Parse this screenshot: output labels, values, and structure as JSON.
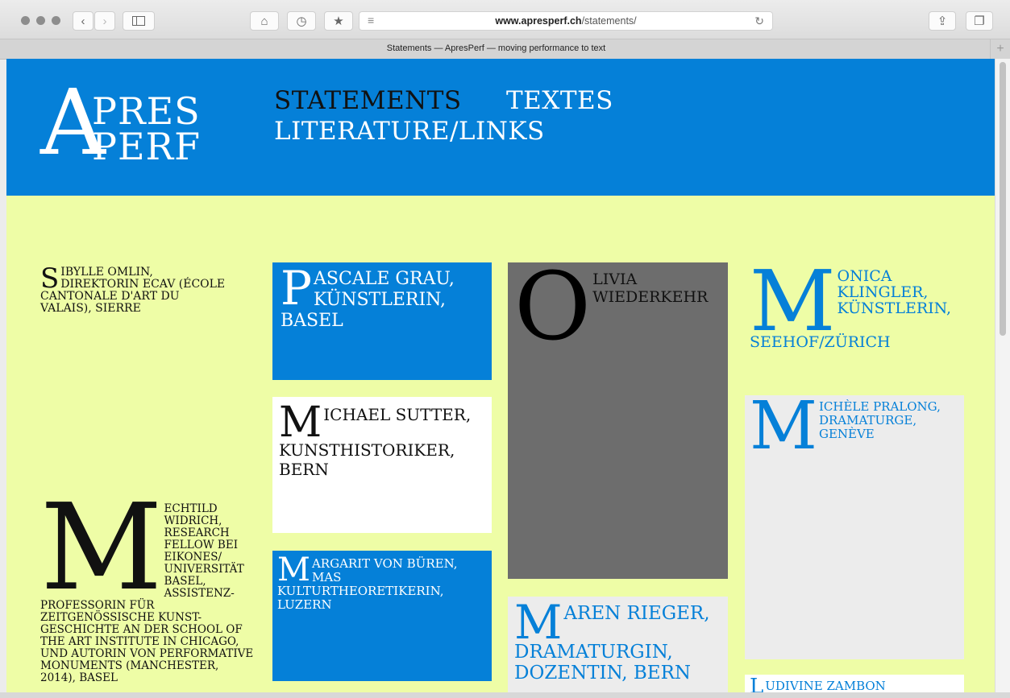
{
  "browser": {
    "url_host": "www.apresperf.ch",
    "url_path": "/statements/",
    "tab_title": "Statements — ApresPerf — moving performance to text"
  },
  "site": {
    "logo": {
      "big_letter": "A",
      "line1": "PRES",
      "line2": "PERF"
    },
    "nav": [
      {
        "label": "STATEMENTS",
        "active": true
      },
      {
        "label": "TEXTES",
        "active": false
      },
      {
        "label": "LITERATURE/LINKS",
        "active": false
      }
    ]
  },
  "colors": {
    "header_blue": "#0580d8",
    "page_bg": "#eefda6",
    "card_grey": "#6d6d6d",
    "card_light": "#ececec"
  },
  "statements": [
    {
      "initial": "S",
      "rest": "IBYLLE OMLIN, DIREKTORIN ECAV (ÉCOLE CANTONALE D'ART DU VALAIS), SIERRE"
    },
    {
      "initial": "P",
      "rest": "ASCALE GRAU, KÜNSTLERIN, BASEL"
    },
    {
      "initial": "O",
      "rest": "LIVIA WIEDERKEHR"
    },
    {
      "initial": "M",
      "rest": "ONICA KLINGLER, KÜNSTLERIN, SEEHOF/ZÜRICH"
    },
    {
      "initial": "M",
      "rest": "ICHAEL SUTTER, KUNSTHISTORIKER, BERN"
    },
    {
      "initial": "M",
      "rest": "ICHÈLE PRALONG, DRAMATURGE, GENÈVE"
    },
    {
      "initial": "M",
      "rest": "ECHTILD WIDRICH, RESEARCH FELLOW BEI EIKONES/ UNIVERSITÄT BASEL, ASSISTENZ-PROFESSORIN FÜR ZEITGENÖSSISCHE KUNST-GESCHICHTE AN DER SCHOOL OF THE ART INSTITUTE IN CHICAGO, UND AUTORIN VON PERFORMATIVE MONUMENTS (MANCHESTER, 2014), BASEL"
    },
    {
      "initial": "M",
      "rest": "ARGARIT VON BÜREN, MAS KULTURTHEORETIKERIN, LUZERN"
    },
    {
      "initial": "M",
      "rest": "AREN RIEGER, DRAMATURGIN, DOZENTIN, BERN"
    },
    {
      "initial": "L",
      "rest": "UDIVINE ZAMBON"
    }
  ]
}
